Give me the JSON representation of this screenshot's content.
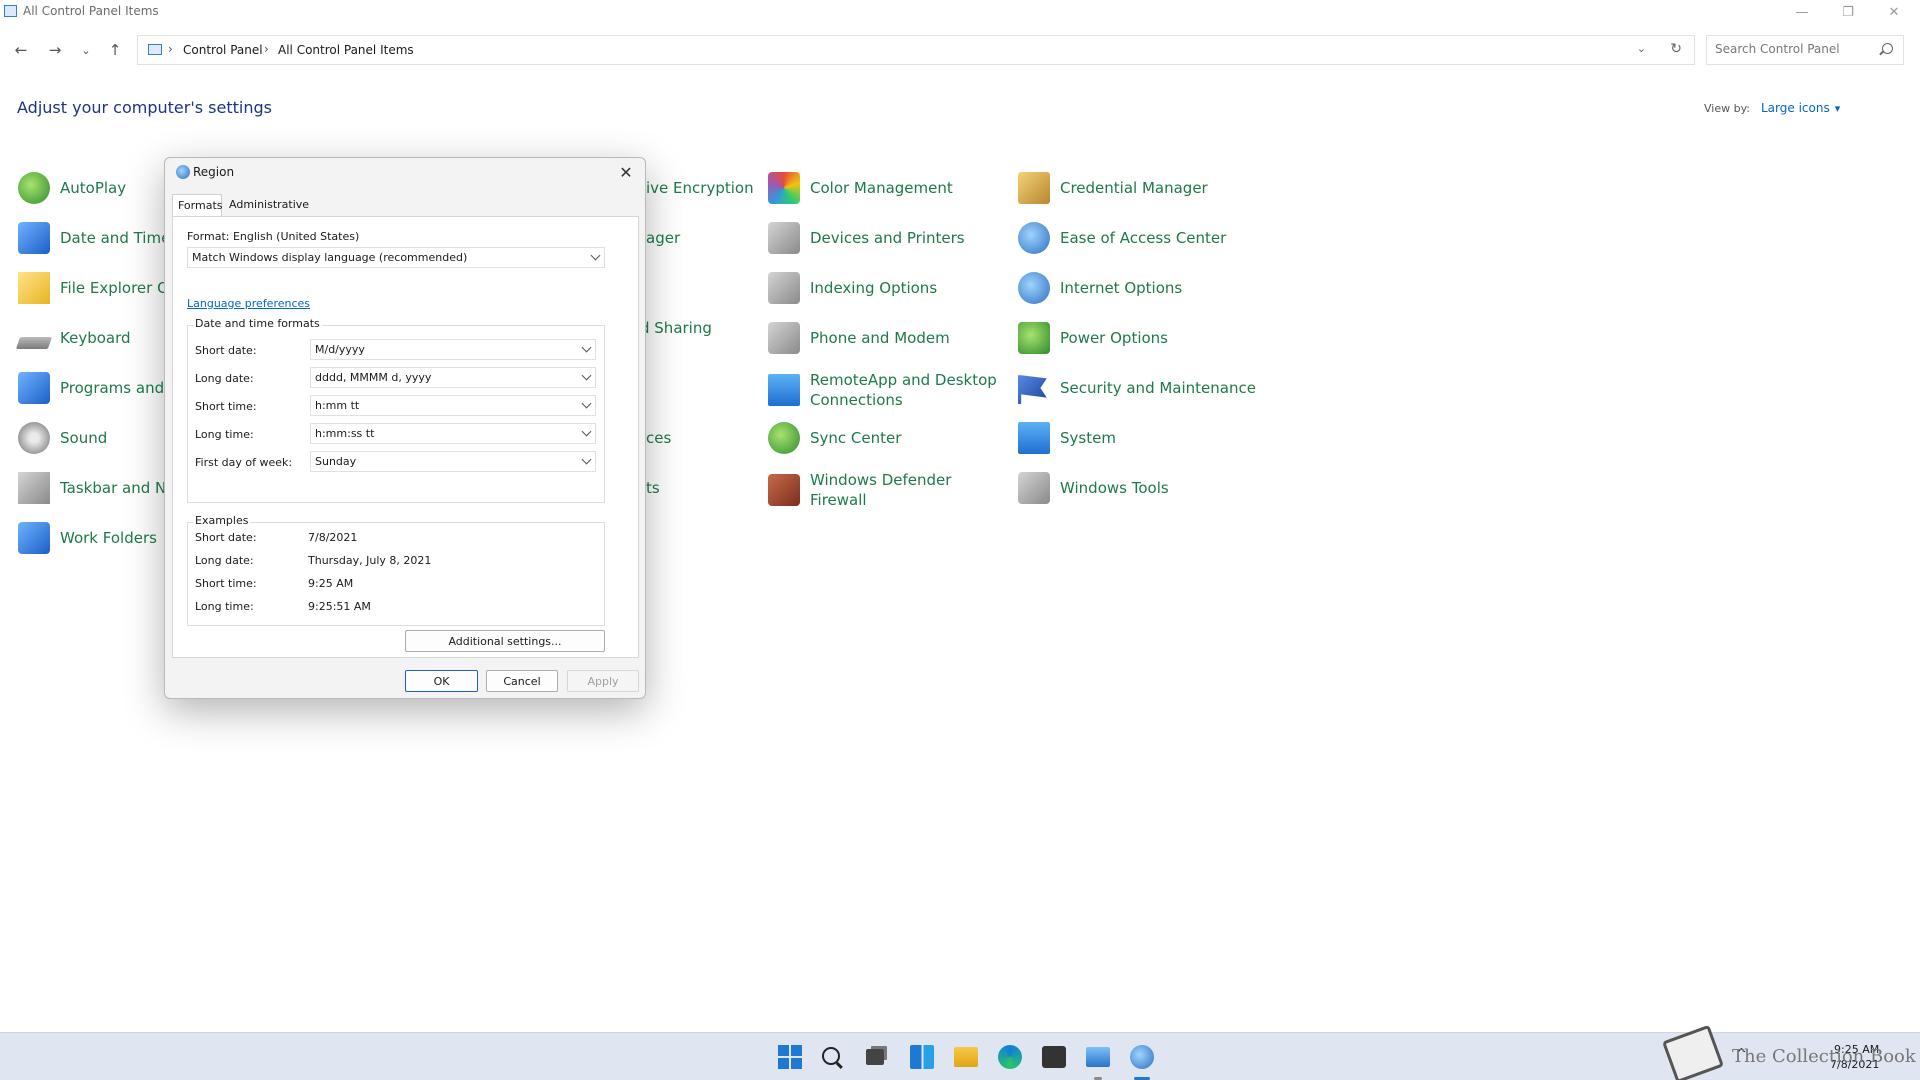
{
  "window": {
    "title": "All Control Panel Items",
    "controls": {
      "minimize": "—",
      "restore": "❐",
      "close": "✕"
    }
  },
  "nav": {
    "back": "←",
    "forward": "→",
    "recent": "⌄",
    "up": "↑"
  },
  "address": {
    "crumbs": [
      "Control Panel",
      "All Control Panel Items"
    ],
    "separator": "›",
    "dropdown": "⌄",
    "refresh": "↻"
  },
  "search": {
    "placeholder": "Search Control Panel",
    "value": ""
  },
  "header": {
    "title": "Adjust your computer's settings",
    "view_by_label": "View by:",
    "view_by_value": "Large icons"
  },
  "items": {
    "col1": [
      {
        "label": "AutoPlay",
        "icon": "autoplay-icon"
      },
      {
        "label": "Date and Time",
        "icon": "date-time-icon"
      },
      {
        "label": "File Explorer O",
        "icon": "file-explorer-options-icon"
      },
      {
        "label": "Keyboard",
        "icon": "keyboard-icon"
      },
      {
        "label": "Programs and",
        "icon": "programs-features-icon"
      },
      {
        "label": "Sound",
        "icon": "sound-icon"
      },
      {
        "label": "Taskbar and Na",
        "icon": "taskbar-navigation-icon"
      },
      {
        "label": "Work Folders",
        "icon": "work-folders-icon"
      }
    ],
    "col2_partial": [
      {
        "label": "ive Encryption"
      },
      {
        "label": "ager"
      },
      {
        "label": "d Sharing"
      },
      {
        "label": "ces"
      },
      {
        "label": "ts"
      }
    ],
    "col3": [
      {
        "label": "Color Management",
        "icon": "color-management-icon"
      },
      {
        "label": "Devices and Printers",
        "icon": "devices-printers-icon"
      },
      {
        "label": "Indexing Options",
        "icon": "indexing-options-icon"
      },
      {
        "label": "Phone and Modem",
        "icon": "phone-modem-icon"
      },
      {
        "label": "RemoteApp and Desktop Connections",
        "icon": "remoteapp-icon"
      },
      {
        "label": "Sync Center",
        "icon": "sync-center-icon"
      },
      {
        "label": "Windows Defender Firewall",
        "icon": "firewall-icon"
      }
    ],
    "col4": [
      {
        "label": "Credential Manager",
        "icon": "credential-manager-icon"
      },
      {
        "label": "Ease of Access Center",
        "icon": "ease-of-access-icon"
      },
      {
        "label": "Internet Options",
        "icon": "internet-options-icon"
      },
      {
        "label": "Power Options",
        "icon": "power-options-icon"
      },
      {
        "label": "Security and Maintenance",
        "icon": "security-maintenance-icon"
      },
      {
        "label": "System",
        "icon": "system-icon"
      },
      {
        "label": "Windows Tools",
        "icon": "windows-tools-icon"
      }
    ]
  },
  "dialog": {
    "title": "Region",
    "close": "✕",
    "tabs": [
      "Formats",
      "Administrative"
    ],
    "format_label": "Format: English (United States)",
    "format_value": "Match Windows display language (recommended)",
    "language_link": "Language preferences",
    "formats_group_title": "Date and time formats",
    "formats": [
      {
        "label": "Short date:",
        "value": "M/d/yyyy"
      },
      {
        "label": "Long date:",
        "value": "dddd, MMMM d, yyyy"
      },
      {
        "label": "Short time:",
        "value": "h:mm tt"
      },
      {
        "label": "Long time:",
        "value": "h:mm:ss tt"
      },
      {
        "label": "First day of week:",
        "value": "Sunday"
      }
    ],
    "examples_group_title": "Examples",
    "examples": [
      {
        "label": "Short date:",
        "value": "7/8/2021"
      },
      {
        "label": "Long date:",
        "value": "Thursday, July 8, 2021"
      },
      {
        "label": "Short time:",
        "value": "9:25 AM"
      },
      {
        "label": "Long time:",
        "value": "9:25:51 AM"
      }
    ],
    "additional_settings": "Additional settings...",
    "ok": "OK",
    "cancel": "Cancel",
    "apply": "Apply"
  },
  "taskbar": {
    "icons": [
      "start-icon",
      "search-icon",
      "task-view-icon",
      "widgets-icon",
      "file-explorer-icon",
      "edge-icon",
      "store-icon",
      "control-panel-icon",
      "region-icon"
    ],
    "tray": {
      "chevron": "^",
      "time": "9:25 AM",
      "date": "7/8/2021"
    },
    "watermark": "The Collection Book"
  }
}
